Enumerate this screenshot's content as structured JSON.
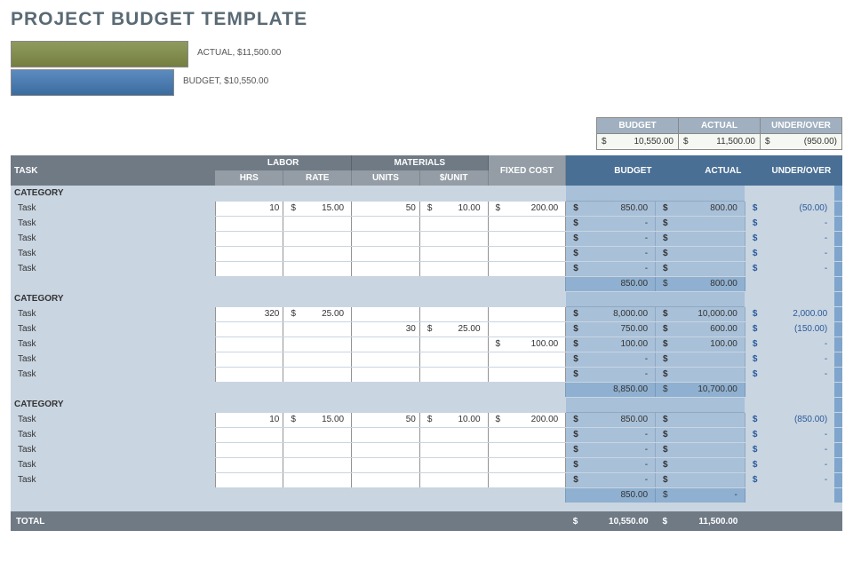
{
  "title": "PROJECT BUDGET TEMPLATE",
  "chart_data": {
    "type": "bar",
    "categories": [
      "ACTUAL",
      "BUDGET"
    ],
    "values": [
      11500.0,
      10550.0
    ],
    "title": "",
    "xlabel": "",
    "ylabel": "",
    "ylim": [
      0,
      12000
    ]
  },
  "chart_labels": {
    "actual": "ACTUAL,  $11,500.00",
    "budget": "BUDGET,  $10,550.00"
  },
  "summary": {
    "headers": {
      "budget": "BUDGET",
      "actual": "ACTUAL",
      "uo": "UNDER/OVER"
    },
    "budget": "10,550.00",
    "actual": "11,500.00",
    "uo": "(950.00)",
    "cur": "$"
  },
  "table": {
    "headers": {
      "task": "TASK",
      "labor": "LABOR",
      "materials": "MATERIALS",
      "hrs": "HRS",
      "rate": "RATE",
      "units": "UNITS",
      "sunit": "$/UNIT",
      "fixed": "FIXED COST",
      "budget": "BUDGET",
      "actual": "ACTUAL",
      "uo": "UNDER/OVER"
    },
    "category_label": "CATEGORY",
    "task_label": "Task",
    "cur": "$",
    "dash": "-",
    "groups": [
      {
        "rows": [
          {
            "hrs": "10",
            "rate": "15.00",
            "units": "50",
            "sunit": "10.00",
            "fixed": "200.00",
            "budget": "850.00",
            "actual": "800.00",
            "uo": "(50.00)"
          },
          {
            "hrs": "",
            "rate": "",
            "units": "",
            "sunit": "",
            "fixed": "",
            "budget": "-",
            "actual": "",
            "uo": "-"
          },
          {
            "hrs": "",
            "rate": "",
            "units": "",
            "sunit": "",
            "fixed": "",
            "budget": "-",
            "actual": "",
            "uo": "-"
          },
          {
            "hrs": "",
            "rate": "",
            "units": "",
            "sunit": "",
            "fixed": "",
            "budget": "-",
            "actual": "",
            "uo": "-"
          },
          {
            "hrs": "",
            "rate": "",
            "units": "",
            "sunit": "",
            "fixed": "",
            "budget": "-",
            "actual": "",
            "uo": "-"
          }
        ],
        "subtotal": {
          "budget": "850.00",
          "actual": "800.00"
        }
      },
      {
        "rows": [
          {
            "hrs": "320",
            "rate": "25.00",
            "units": "",
            "sunit": "",
            "fixed": "",
            "budget": "8,000.00",
            "actual": "10,000.00",
            "uo": "2,000.00"
          },
          {
            "hrs": "",
            "rate": "",
            "units": "30",
            "sunit": "25.00",
            "fixed": "",
            "budget": "750.00",
            "actual": "600.00",
            "uo": "(150.00)"
          },
          {
            "hrs": "",
            "rate": "",
            "units": "",
            "sunit": "",
            "fixed": "100.00",
            "budget": "100.00",
            "actual": "100.00",
            "uo": "-"
          },
          {
            "hrs": "",
            "rate": "",
            "units": "",
            "sunit": "",
            "fixed": "",
            "budget": "-",
            "actual": "",
            "uo": "-"
          },
          {
            "hrs": "",
            "rate": "",
            "units": "",
            "sunit": "",
            "fixed": "",
            "budget": "-",
            "actual": "",
            "uo": "-"
          }
        ],
        "subtotal": {
          "budget": "8,850.00",
          "actual": "10,700.00"
        }
      },
      {
        "rows": [
          {
            "hrs": "10",
            "rate": "15.00",
            "units": "50",
            "sunit": "10.00",
            "fixed": "200.00",
            "budget": "850.00",
            "actual": "",
            "uo": "(850.00)"
          },
          {
            "hrs": "",
            "rate": "",
            "units": "",
            "sunit": "",
            "fixed": "",
            "budget": "-",
            "actual": "",
            "uo": "-"
          },
          {
            "hrs": "",
            "rate": "",
            "units": "",
            "sunit": "",
            "fixed": "",
            "budget": "-",
            "actual": "",
            "uo": "-"
          },
          {
            "hrs": "",
            "rate": "",
            "units": "",
            "sunit": "",
            "fixed": "",
            "budget": "-",
            "actual": "",
            "uo": "-"
          },
          {
            "hrs": "",
            "rate": "",
            "units": "",
            "sunit": "",
            "fixed": "",
            "budget": "-",
            "actual": "",
            "uo": "-"
          }
        ],
        "subtotal": {
          "budget": "850.00",
          "actual": "-"
        }
      }
    ],
    "total": {
      "label": "TOTAL",
      "budget": "10,550.00",
      "actual": "11,500.00"
    }
  }
}
